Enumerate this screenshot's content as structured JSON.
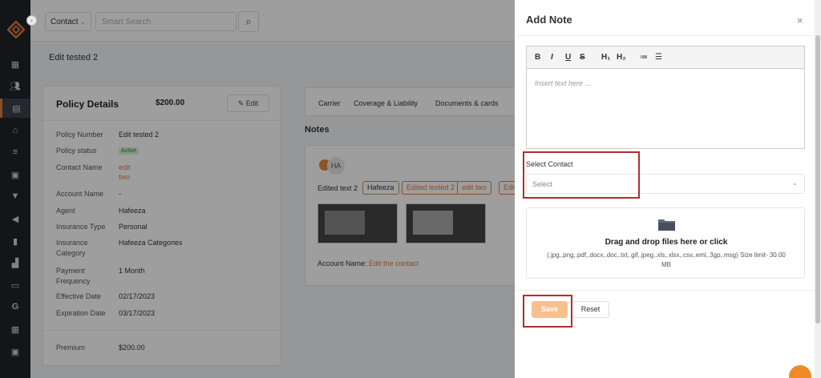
{
  "search": {
    "contact_dropdown": "Contact",
    "placeholder": "Smart Search"
  },
  "breadcrumb": "Edit tested 2",
  "policy": {
    "title": "Policy Details",
    "amount": "$200.00",
    "edit_label": "Edit",
    "rows": [
      {
        "label": "Policy Number",
        "value": "Edit tested 2"
      },
      {
        "label": "Policy status",
        "value": "Active"
      },
      {
        "label": "Contact Name",
        "value_line1": "edit",
        "value_line2": "two"
      },
      {
        "label": "Account Name",
        "value": "-"
      },
      {
        "label": "Agent",
        "value": "Hafeeza"
      },
      {
        "label": "Insurance Type",
        "value": "Personal"
      },
      {
        "label": "Insurance Category",
        "value": "Hafeeza Categories"
      },
      {
        "label": "Payment Frequency",
        "value": "1 Month"
      },
      {
        "label": "Effective Date",
        "value": "02/17/2023"
      },
      {
        "label": "Expiration Date",
        "value": "03/17/2023"
      },
      {
        "label": "Premium",
        "value": "$200.00"
      }
    ]
  },
  "tabs": [
    "Carrier",
    "Coverage & Liability",
    "Documents & cards"
  ],
  "notes": {
    "title": "Notes",
    "avatar_initials": "HA",
    "text": "Edited text 2",
    "chips": [
      "Hafeeza",
      "Edited tested 2",
      "edit two",
      "Edit"
    ],
    "account_label": "Account Name:",
    "account_link": "Edit the contact"
  },
  "drawer": {
    "title": "Add Note",
    "close": "×",
    "toolbar": [
      "B",
      "I",
      "U",
      "S",
      "H₁",
      "H₂",
      "≔",
      "☰"
    ],
    "editor_placeholder": "Insert text here ...",
    "select_label": "Select Contact",
    "select_placeholder": "Select",
    "drop_title": "Drag and drop files here or click",
    "drop_sub": "(.jpg,.png,.pdf,.docx,.doc,.txt,.gif,.jpeg,.xls,.xlsx,.csv,.eml,.3gp,.msg) Size limit- 30.00 MB",
    "save_label": "Save",
    "reset_label": "Reset"
  },
  "colors": {
    "accent": "#e07a3f",
    "highlight": "#b32d2e",
    "save_disabled": "#f7c08f"
  },
  "icons": [
    "collapse-icon",
    "dashboard-icon",
    "users-icon",
    "policies-icon",
    "bank-icon",
    "list-icon",
    "contacts-icon",
    "funnel-icon",
    "megaphone-icon",
    "document-icon",
    "reports-icon",
    "folder-icon",
    "google-icon",
    "calendar-icon",
    "calendar-alt-icon",
    "search-icon",
    "pencil-icon",
    "folder-icon",
    "chat-icon"
  ]
}
